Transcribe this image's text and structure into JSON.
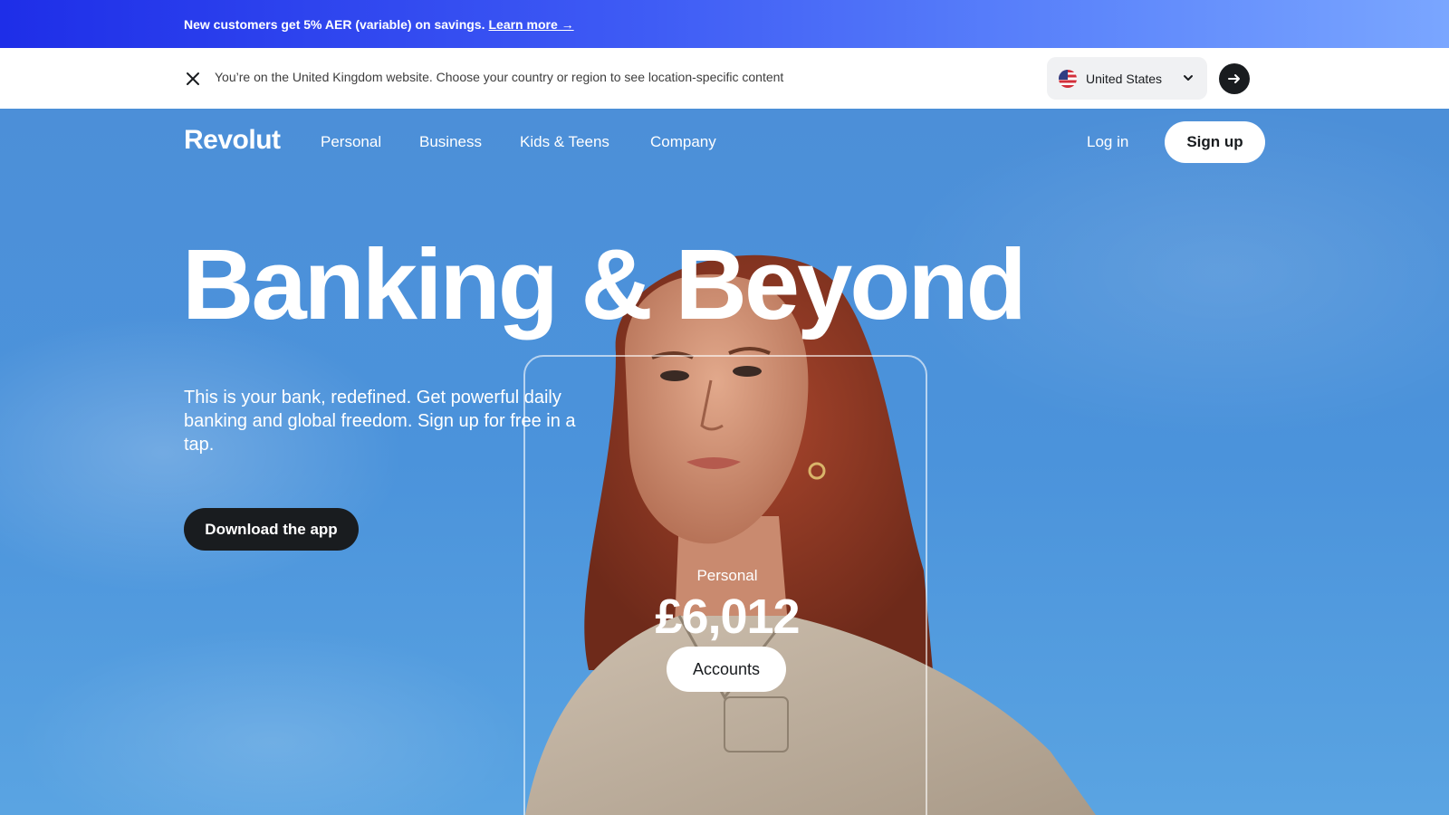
{
  "promo": {
    "text": "New customers get 5% AER (variable) on savings.",
    "link": "Learn more →"
  },
  "region_bar": {
    "message": "You’re on the United Kingdom website. Choose your country or region to see location-specific content",
    "selected_country": "United States",
    "icons": [
      "close-icon",
      "us-flag-icon",
      "chevron-down-icon",
      "arrow-right-icon"
    ]
  },
  "nav": {
    "logo": "Revolut",
    "links": [
      "Personal",
      "Business",
      "Kids & Teens",
      "Company"
    ],
    "login": "Log in",
    "signup": "Sign up"
  },
  "hero": {
    "headline": "Banking & Beyond",
    "subtitle": "This is your bank, redefined. Get powerful daily banking and global freedom. Sign up for free in a tap.",
    "cta": "Download the app"
  },
  "card": {
    "label": "Personal",
    "amount": "£6,012",
    "button": "Accounts"
  },
  "colors": {
    "promo_gradient_start": "#1e2ee8",
    "promo_gradient_end": "#7aa6ff",
    "sky": "#4b93db",
    "dark": "#191c1f",
    "white": "#ffffff"
  }
}
